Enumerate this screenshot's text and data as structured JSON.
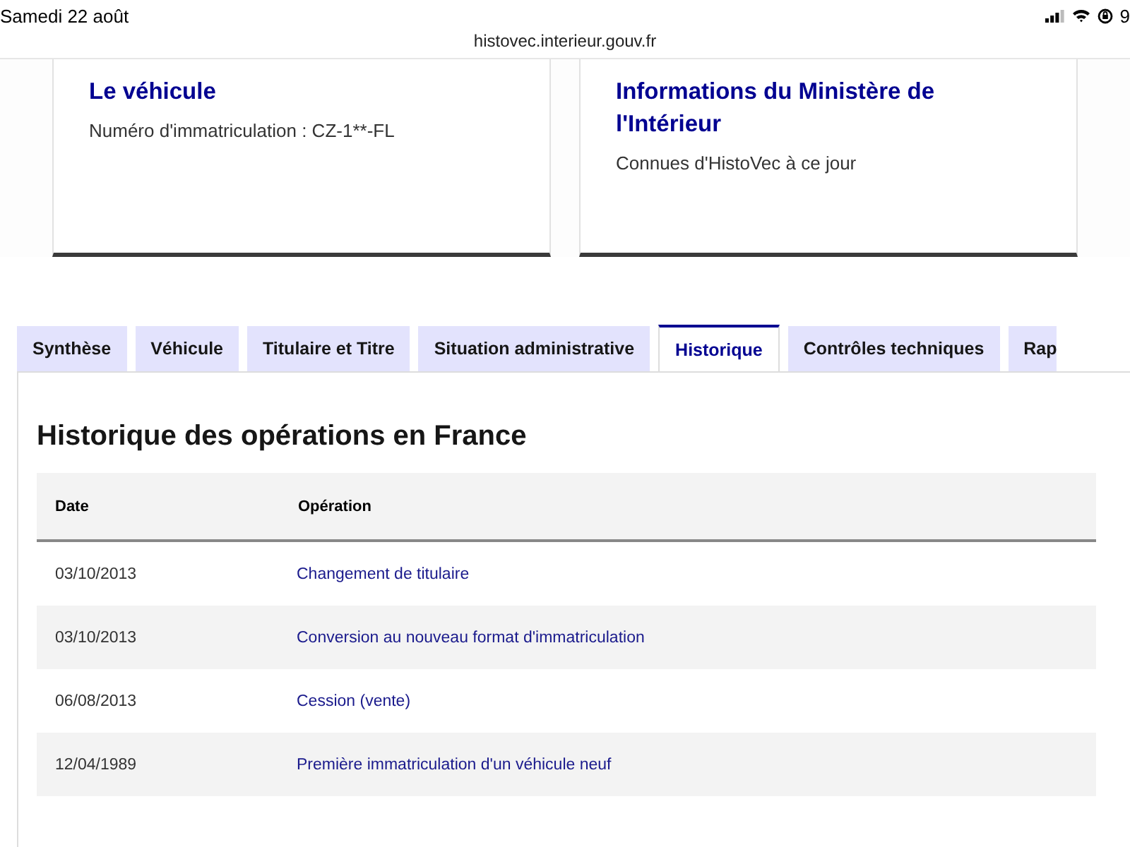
{
  "status_bar": {
    "date": "Samedi 22 août",
    "battery": "9"
  },
  "address_bar": {
    "url": "histovec.interieur.gouv.fr"
  },
  "cards": [
    {
      "title": "Le véhicule",
      "text": "Numéro d'immatriculation : CZ-1**-FL"
    },
    {
      "title": "Informations du Ministère de l'Intérieur",
      "text": "Connues d'HistoVec à ce jour"
    }
  ],
  "tabs": [
    {
      "label": "Synthèse",
      "selected": false
    },
    {
      "label": "Véhicule",
      "selected": false
    },
    {
      "label": "Titulaire et Titre",
      "selected": false
    },
    {
      "label": "Situation administrative",
      "selected": false
    },
    {
      "label": "Historique",
      "selected": true
    },
    {
      "label": "Contrôles techniques",
      "selected": false
    },
    {
      "label": "Rap",
      "selected": false
    }
  ],
  "section": {
    "title": "Historique des opérations en France"
  },
  "table": {
    "columns": [
      "Date",
      "Opération"
    ],
    "rows": [
      [
        "03/10/2013",
        "Changement de titulaire"
      ],
      [
        "03/10/2013",
        "Conversion au nouveau format d'immatriculation"
      ],
      [
        "06/08/2013",
        "Cession (vente)"
      ],
      [
        "12/04/1989",
        "Première immatriculation d'un véhicule neuf"
      ]
    ]
  }
}
